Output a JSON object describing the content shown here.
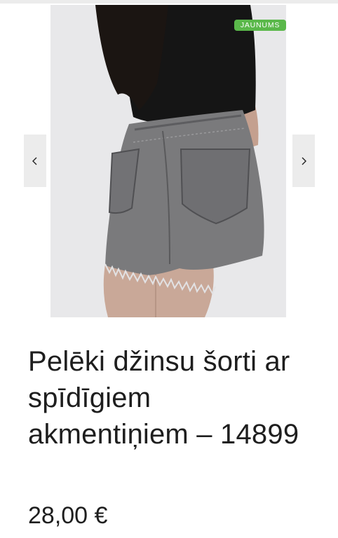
{
  "product": {
    "badge": "JAUNUMS",
    "title": "Pelēki džinsu šorti ar spīdīgiem akmentiņiem – 14899",
    "price": "28,00 €"
  },
  "gallery": {
    "prev_icon": "chevron-left-icon",
    "next_icon": "chevron-right-icon"
  },
  "colors": {
    "badge_bg": "#5ab84a",
    "nav_bg": "#ececec",
    "text": "#1e1e1e"
  }
}
